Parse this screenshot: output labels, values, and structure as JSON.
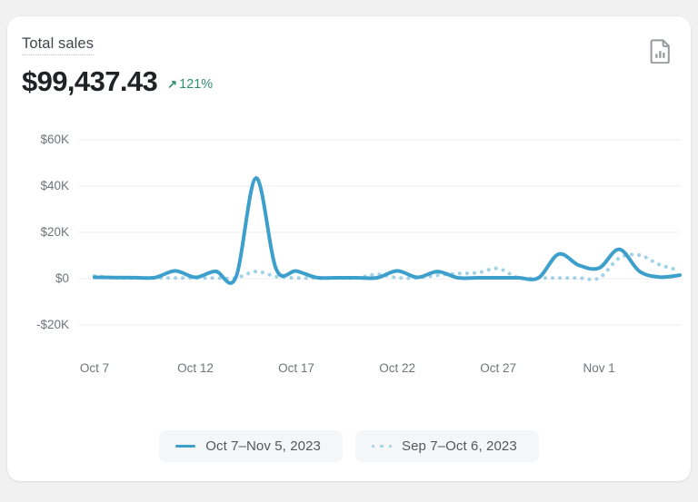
{
  "card": {
    "metric_label": "Total sales",
    "metric_value": "$99,437.43",
    "delta_arrow": "↗",
    "delta_value": "121%",
    "delta_color": "#2e8f6d",
    "report_icon": "document-bar-chart-icon"
  },
  "legend": {
    "items": [
      {
        "label": "Oct 7–Nov 5, 2023",
        "style": "solid",
        "color": "#3d9fcb"
      },
      {
        "label": "Sep 7–Oct 6, 2023",
        "style": "dotted",
        "color": "#9fd2e6"
      }
    ]
  },
  "chart_data": {
    "type": "line",
    "title": "Total sales",
    "xlabel": "",
    "ylabel": "",
    "grid": true,
    "legend_position": "bottom",
    "ylim": [
      -20000,
      60000
    ],
    "ytick_labels": [
      "$60K",
      "$40K",
      "$20K",
      "$0",
      "-$20K"
    ],
    "ytick_values": [
      60000,
      40000,
      20000,
      0,
      -20000
    ],
    "xtick_labels": [
      "Oct 7",
      "Oct 12",
      "Oct 17",
      "Oct 22",
      "Oct 27",
      "Nov 1"
    ],
    "xtick_indices": [
      0,
      5,
      10,
      15,
      20,
      25
    ],
    "x": [
      "Oct 7",
      "Oct 8",
      "Oct 9",
      "Oct 10",
      "Oct 11",
      "Oct 12",
      "Oct 13",
      "Oct 14",
      "Oct 15",
      "Oct 16",
      "Oct 17",
      "Oct 18",
      "Oct 19",
      "Oct 20",
      "Oct 21",
      "Oct 22",
      "Oct 23",
      "Oct 24",
      "Oct 25",
      "Oct 26",
      "Oct 27",
      "Oct 28",
      "Oct 29",
      "Oct 30",
      "Oct 31",
      "Nov 1",
      "Nov 2",
      "Nov 3",
      "Nov 4",
      "Nov 5"
    ],
    "series": [
      {
        "name": "Oct 7–Nov 5, 2023",
        "style": "solid",
        "color": "#3d9fcb",
        "values": [
          600,
          500,
          450,
          500,
          3400,
          600,
          3200,
          500,
          43500,
          4200,
          3300,
          500,
          400,
          400,
          400,
          3400,
          600,
          3100,
          400,
          400,
          400,
          400,
          400,
          10600,
          5800,
          4600,
          12700,
          3200,
          700,
          1500
        ]
      },
      {
        "name": "Sep 7–Oct 6, 2023",
        "style": "dotted",
        "color": "#9fd2e6",
        "values": [
          1200,
          400,
          300,
          300,
          300,
          300,
          300,
          300,
          3100,
          900,
          300,
          300,
          300,
          300,
          1900,
          400,
          300,
          1500,
          2200,
          2600,
          4400,
          400,
          300,
          300,
          300,
          300,
          8900,
          10200,
          6000,
          3600
        ]
      }
    ]
  }
}
